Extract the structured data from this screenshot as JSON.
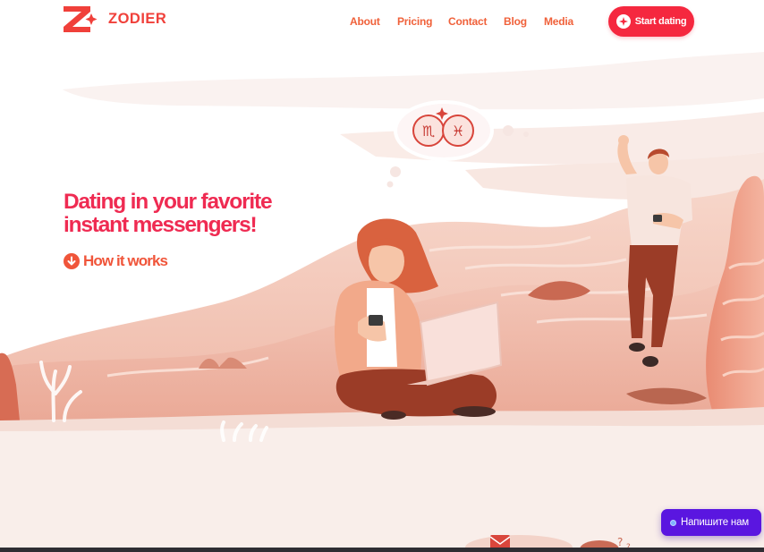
{
  "brand": {
    "name": "ZODIER",
    "logo_icon": "zodier-z-logo-icon"
  },
  "nav": {
    "items": [
      {
        "label": "About"
      },
      {
        "label": "Pricing"
      },
      {
        "label": "Contact"
      },
      {
        "label": "Blog"
      },
      {
        "label": "Media"
      }
    ],
    "cta_label": "Start dating",
    "cta_icon": "sparkle-icon"
  },
  "hero": {
    "title_line1": "Dating in your favorite",
    "title_line2": "instant messengers!",
    "how_label": "How it works",
    "how_icon": "arrow-down-circle-icon"
  },
  "illustration": {
    "thought_bubble_symbols": [
      "♏",
      "♓"
    ]
  },
  "chat_widget": {
    "label": "Напишите нам"
  },
  "colors": {
    "brand_red": "#f0403a",
    "title_pink": "#ef2b52",
    "cta_red": "#f5283f",
    "chat_purple": "#5a16e0",
    "sand": "#f7e9e3"
  }
}
